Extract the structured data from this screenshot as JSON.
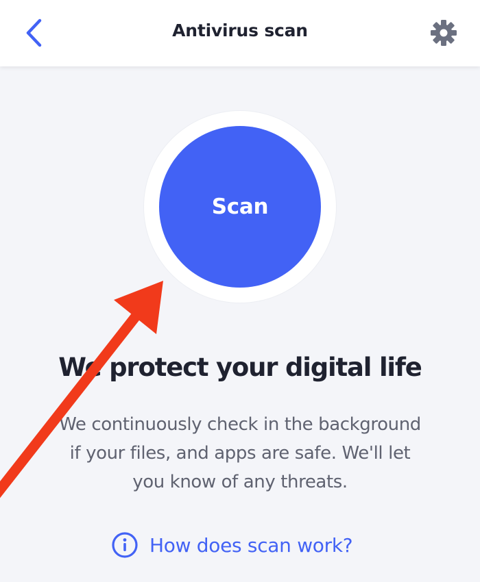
{
  "header": {
    "title": "Antivirus scan",
    "back_icon": "chevron-left-icon",
    "settings_icon": "gear-icon"
  },
  "scan": {
    "button_label": "Scan"
  },
  "content": {
    "headline": "We protect your digital life",
    "description_lines": [
      "We continuously check in the background",
      "if your files, and apps are safe. We'll let",
      "you know of any threats."
    ]
  },
  "help": {
    "icon": "info-icon",
    "label": "How does scan work?"
  },
  "colors": {
    "accent": "#4262f5",
    "header_bg": "#ffffff",
    "page_bg": "#f4f5f9",
    "text_dark": "#1f2230",
    "text_muted": "#5f6270",
    "icon_gray": "#6b7080",
    "annotation_red": "#f13a1b"
  }
}
